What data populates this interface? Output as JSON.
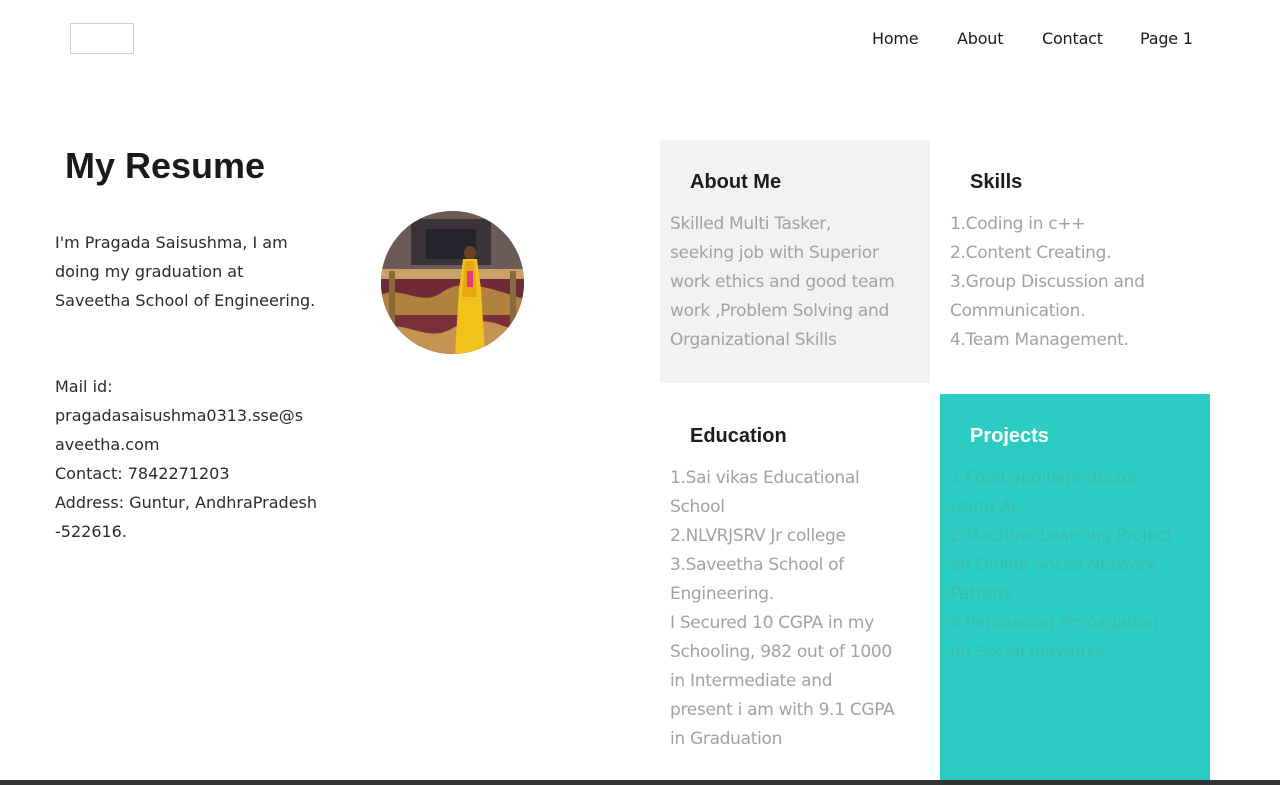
{
  "nav": {
    "logo_alt": "",
    "items": [
      {
        "label": "Home"
      },
      {
        "label": "About"
      },
      {
        "label": "Contact"
      },
      {
        "label": "Page 1"
      }
    ]
  },
  "main": {
    "title": "My Resume",
    "intro_lines": [
      "I'm Pragada Saisushma, I am",
      "doing my graduation at",
      "Saveetha School of Engineering."
    ],
    "contact_lines": [
      "Mail id:",
      "pragadasaisushma0313.sse@s",
      "aveetha.com",
      "Contact: 7842271203",
      "Address: Guntur, AndhraPradesh",
      "-522616."
    ]
  },
  "about_me": {
    "heading": "About Me",
    "lines": [
      "Skilled Multi Tasker,",
      "seeking job with Superior",
      "work ethics and good team",
      "work ,Problem Solving and",
      "Organizational Skills"
    ]
  },
  "skills": {
    "heading": "Skills",
    "lines": [
      "1.Coding in c++",
      "2.Content Creating.",
      "3.Group Discussion and",
      "Communication.",
      "4.Team Management."
    ]
  },
  "education": {
    "heading": "Education",
    "lines": [
      "1.Sai vikas Educational",
      "School",
      "2.NLVRJSRV Jr college",
      "3.Saveetha School of",
      "Engineering.",
      "I Secured 10 CGPA in my",
      "Schooling, 982 out of 1000",
      "in Intermediate and",
      "present i am with 9.1 CGPA",
      "in Graduation"
    ]
  },
  "projects": {
    "heading": "Projects",
    "lines": [
      "1.Food Spoilage dector",
      "using AI",
      "2.Machine Learning Project",
      "on Online Social Network",
      "Patrons",
      "3.Persuasion Propagation",
      "on Social networks"
    ]
  },
  "colors": {
    "accent_teal": "#2cccc4",
    "card_grey": "#f2f2f2",
    "muted_text": "#a2a2a2"
  }
}
